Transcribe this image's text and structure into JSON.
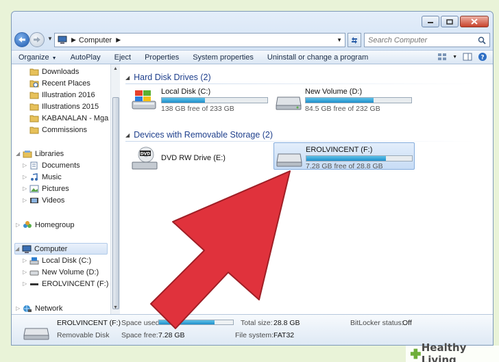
{
  "window": {
    "buttons": {
      "minimize": "minimize-icon",
      "maximize": "maximize-icon",
      "close": "close-icon"
    }
  },
  "address": {
    "crumb": "Computer"
  },
  "search": {
    "placeholder": "Search Computer"
  },
  "toolbar": {
    "items": [
      "Organize",
      "AutoPlay",
      "Eject",
      "Properties",
      "System properties",
      "Uninstall or change a program"
    ]
  },
  "sidebar": {
    "favorites": [
      "Downloads",
      "Recent Places",
      "Illustration 2016",
      "Illustrations 2015",
      "KABANALAN - Mga Fil",
      "Commissions"
    ],
    "libraries": {
      "label": "Libraries",
      "items": [
        "Documents",
        "Music",
        "Pictures",
        "Videos"
      ]
    },
    "homegroup": "Homegroup",
    "computer": {
      "label": "Computer",
      "items": [
        "Local Disk (C:)",
        "New Volume (D:)",
        "EROLVINCENT (F:)"
      ]
    },
    "network": "Network"
  },
  "groups": {
    "hard_disks": {
      "title": "Hard Disk Drives (2)"
    },
    "removable": {
      "title": "Devices with Removable Storage (2)"
    }
  },
  "drives": {
    "c": {
      "name": "Local Disk (C:)",
      "free": "138 GB free of 233 GB",
      "used_fraction": 0.41
    },
    "d": {
      "name": "New Volume (D:)",
      "free": "84.5 GB free of 232 GB",
      "used_fraction": 0.64
    },
    "e": {
      "name": "DVD RW Drive (E:)"
    },
    "f": {
      "name": "EROLVINCENT (F:)",
      "free": "7.28 GB free of 28.8 GB",
      "used_fraction": 0.75
    }
  },
  "details": {
    "name": "EROLVINCENT (F:)",
    "type": "Removable Disk",
    "space_used_label": "Space used:",
    "space_free_label": "Space free:",
    "space_free": "7.28 GB",
    "total_size_label": "Total size:",
    "total_size": "28.8 GB",
    "file_system_label": "File system:",
    "file_system": "FAT32",
    "bitlocker_label": "BitLocker status:",
    "bitlocker": "Off",
    "used_fraction": 0.75
  },
  "watermark": {
    "text": "Healthy Living"
  },
  "colors": {
    "arrow": "#e0323c",
    "accent": "#1e3f8c",
    "bar": "#1f8fcb"
  }
}
